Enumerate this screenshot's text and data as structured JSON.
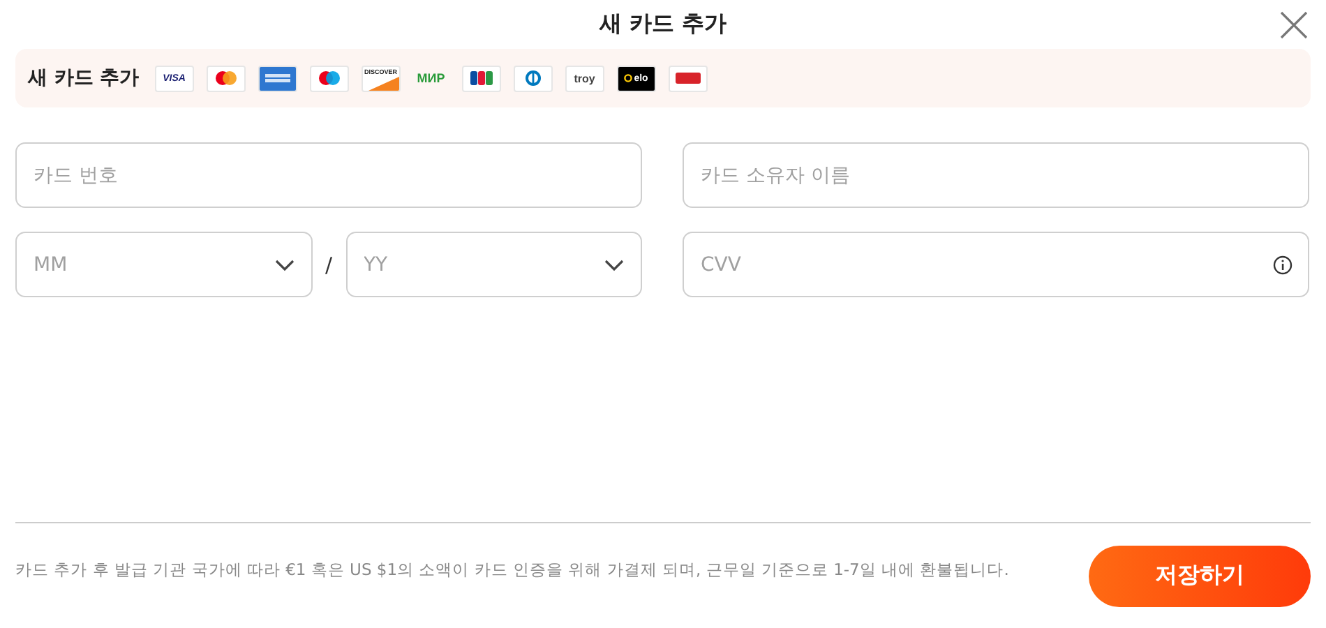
{
  "dialog": {
    "title": "새 카드 추가"
  },
  "brand_strip": {
    "label": "새 카드 추가",
    "brands": [
      {
        "kind": "visa",
        "label": "VISA"
      },
      {
        "kind": "mastercard"
      },
      {
        "kind": "amex"
      },
      {
        "kind": "maestro"
      },
      {
        "kind": "discover",
        "label": "DISCOVER"
      },
      {
        "kind": "mir",
        "label": "МИР"
      },
      {
        "kind": "jcb"
      },
      {
        "kind": "diners"
      },
      {
        "kind": "troy",
        "label": "troy"
      },
      {
        "kind": "elo",
        "label": "elo"
      },
      {
        "kind": "hipercard"
      }
    ]
  },
  "fields": {
    "card_number": {
      "placeholder": "카드 번호"
    },
    "card_holder": {
      "placeholder": "카드 소유자 이름"
    },
    "month": {
      "placeholder": "MM"
    },
    "separator": "/",
    "year": {
      "placeholder": "YY"
    },
    "cvv": {
      "placeholder": "CVV"
    }
  },
  "footer": {
    "note": "카드 추가 후 발급 기관 국가에 따라 €1 혹은 US $1의 소액이 카드 인증을 위해 가결제 되며, 근무일 기준으로 1-7일 내에 환불됩니다.",
    "save_button": "저장하기"
  }
}
